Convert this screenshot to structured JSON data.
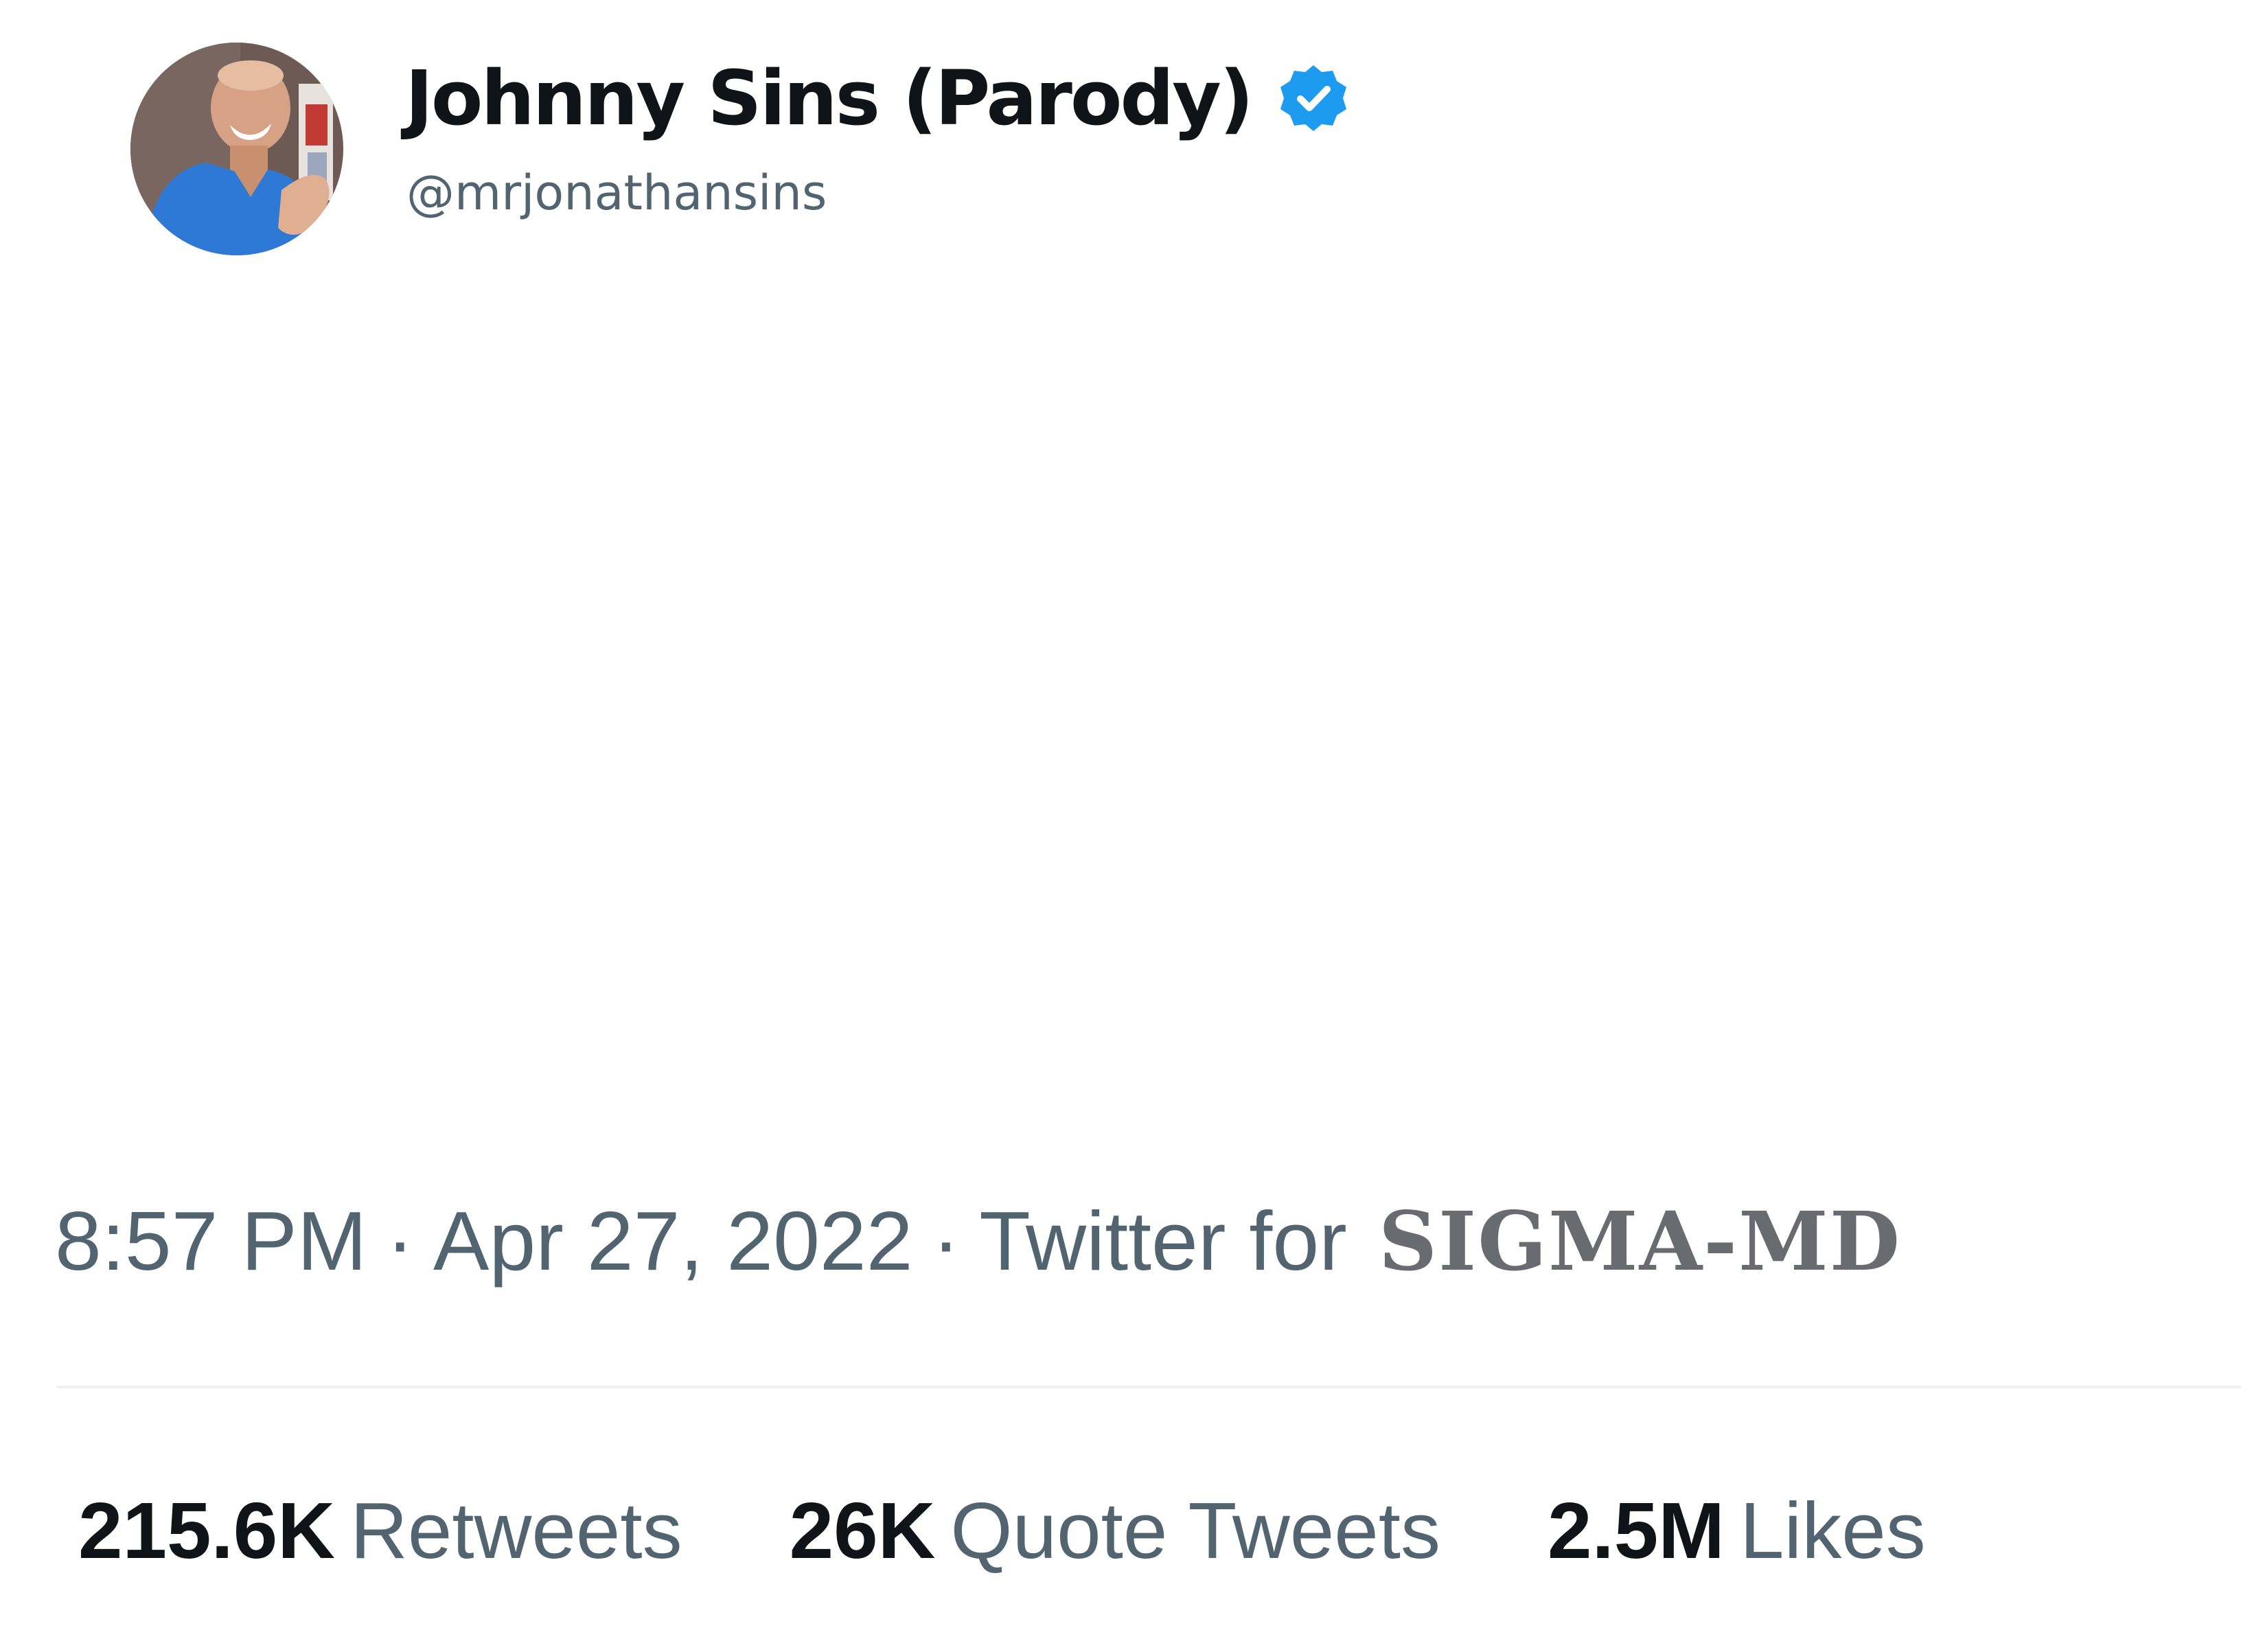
{
  "profile": {
    "display_name": "Johnny Sins (Parody)",
    "handle": "@mrjonathansins",
    "verified": true,
    "verified_color": "#1d9bf0",
    "avatar": "profile-photo"
  },
  "tweet_meta": {
    "time": "8:57 PM",
    "separator": "·",
    "date": "Apr 27, 2022",
    "source_prefix": "Twitter for",
    "source_app": "SIGMA-MD"
  },
  "stats": {
    "retweets": {
      "count": "215.6K",
      "label": "Retweets"
    },
    "quote_tweets": {
      "count": "26K",
      "label": "Quote Tweets"
    },
    "likes": {
      "count": "2.5M",
      "label": "Likes"
    }
  },
  "colors": {
    "primary_text": "#0f1419",
    "secondary_text": "#536471",
    "divider": "#eff1f3"
  }
}
